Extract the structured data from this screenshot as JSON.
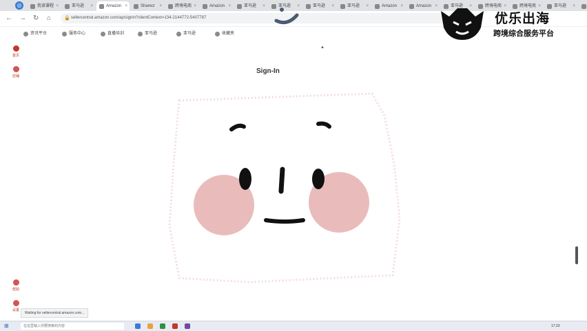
{
  "browser": {
    "tabs": [
      {
        "label": "我读课程",
        "active": false
      },
      {
        "label": "亚马逊",
        "active": false
      },
      {
        "label": "Amazon",
        "active": true
      },
      {
        "label": "Sharecr",
        "active": false
      },
      {
        "label": "跨境电商",
        "active": false
      },
      {
        "label": "Amazon",
        "active": false
      },
      {
        "label": "亚马逊",
        "active": false
      },
      {
        "label": "亚马逊",
        "active": false
      },
      {
        "label": "亚马逊",
        "active": false
      },
      {
        "label": "亚马逊",
        "active": false
      },
      {
        "label": "Amazon",
        "active": false
      },
      {
        "label": "Amazon",
        "active": false
      },
      {
        "label": "亚马逊",
        "active": false
      },
      {
        "label": "跨境电商",
        "active": false
      },
      {
        "label": "跨境电商",
        "active": false
      },
      {
        "label": "亚马逊",
        "active": false
      },
      {
        "label": "亚马逊",
        "active": false
      }
    ],
    "url": "sellercentral.amazon.com/ap/signin?clientContext=134-2144772-5407787",
    "bookmarks": [
      "资讯平台",
      "服务中心",
      "直播培训",
      "亚马逊",
      "亚马逊",
      "收藏夹"
    ]
  },
  "sidebar": {
    "items": [
      {
        "label": "首页",
        "icon": "home-icon",
        "color": "#c0392b"
      },
      {
        "label": "店铺",
        "icon": "store-icon",
        "color": "#d35454"
      },
      {
        "label": "帮助",
        "icon": "help-icon",
        "color": "#d35454"
      },
      {
        "label": "设置",
        "icon": "gear-icon",
        "color": "#d35454"
      }
    ]
  },
  "page": {
    "heading": "Sign-In"
  },
  "status": {
    "text": "Waiting for sellercentral.amazon.com..."
  },
  "taskbar": {
    "search_placeholder": "在这里输入你要搜索的内容",
    "time": "17:23"
  },
  "watermark": {
    "brand": "优乐出海",
    "subtitle": "跨境综合服务平台"
  },
  "colors": {
    "cheek": "#e9bcbb",
    "accent": "#c0392b",
    "tabbar": "#dfe1e5"
  }
}
